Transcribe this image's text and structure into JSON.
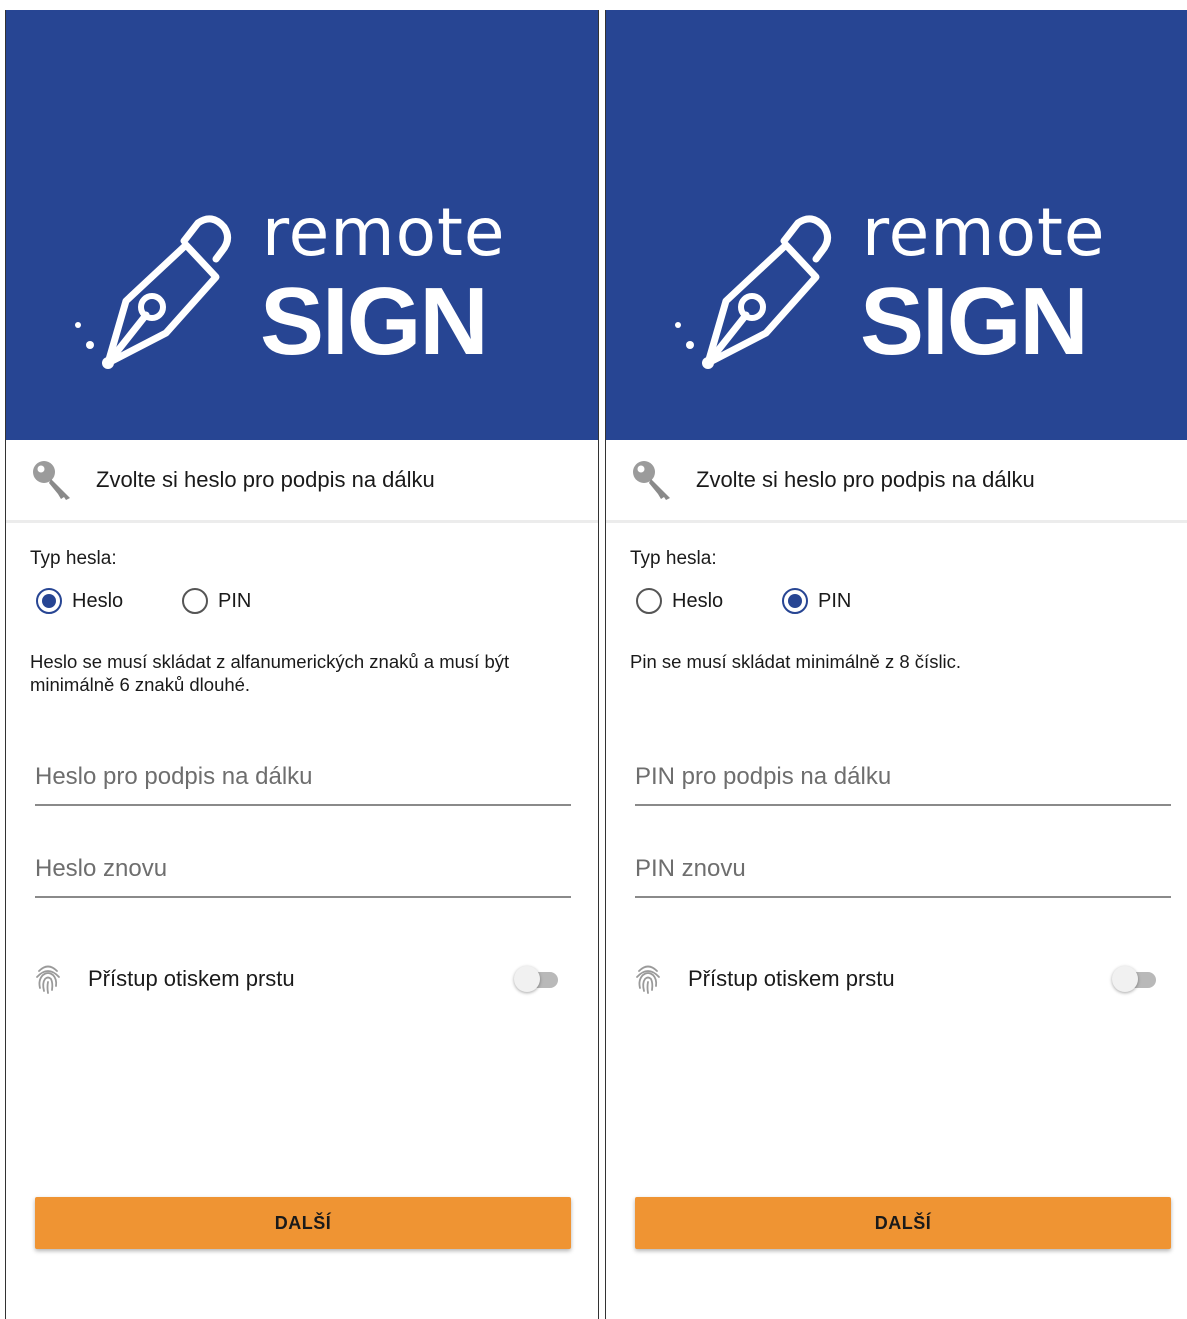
{
  "app": {
    "logo_top": "remote",
    "logo_bottom": "SIGN",
    "brand_color": "#274593",
    "accent_color": "#ef9433"
  },
  "screens": [
    {
      "title": "Zvolte si heslo pro podpis na dálku",
      "type_label": "Typ hesla:",
      "radio_options": [
        {
          "label": "Heslo",
          "checked": true
        },
        {
          "label": "PIN",
          "checked": false
        }
      ],
      "hint": "Heslo se musí skládat z alfanumerických znaků a musí být minimálně 6 znaků dlouhé.",
      "field_1_placeholder": "Heslo pro podpis na dálku",
      "field_2_placeholder": "Heslo znovu",
      "fingerprint_label": "Přístup otiskem prstu",
      "fingerprint_enabled": false,
      "next_label": "DALŠÍ",
      "icons": [
        "key-icon",
        "fingerprint-icon",
        "fountain-pen-icon"
      ]
    },
    {
      "title": "Zvolte si heslo pro podpis na dálku",
      "type_label": "Typ hesla:",
      "radio_options": [
        {
          "label": "Heslo",
          "checked": false
        },
        {
          "label": "PIN",
          "checked": true
        }
      ],
      "hint": "Pin se musí skládat minimálně z 8 číslic.",
      "field_1_placeholder": "PIN pro podpis na dálku",
      "field_2_placeholder": "PIN znovu",
      "fingerprint_label": "Přístup otiskem prstu",
      "fingerprint_enabled": false,
      "next_label": "DALŠÍ",
      "icons": [
        "key-icon",
        "fingerprint-icon",
        "fountain-pen-icon"
      ]
    }
  ]
}
